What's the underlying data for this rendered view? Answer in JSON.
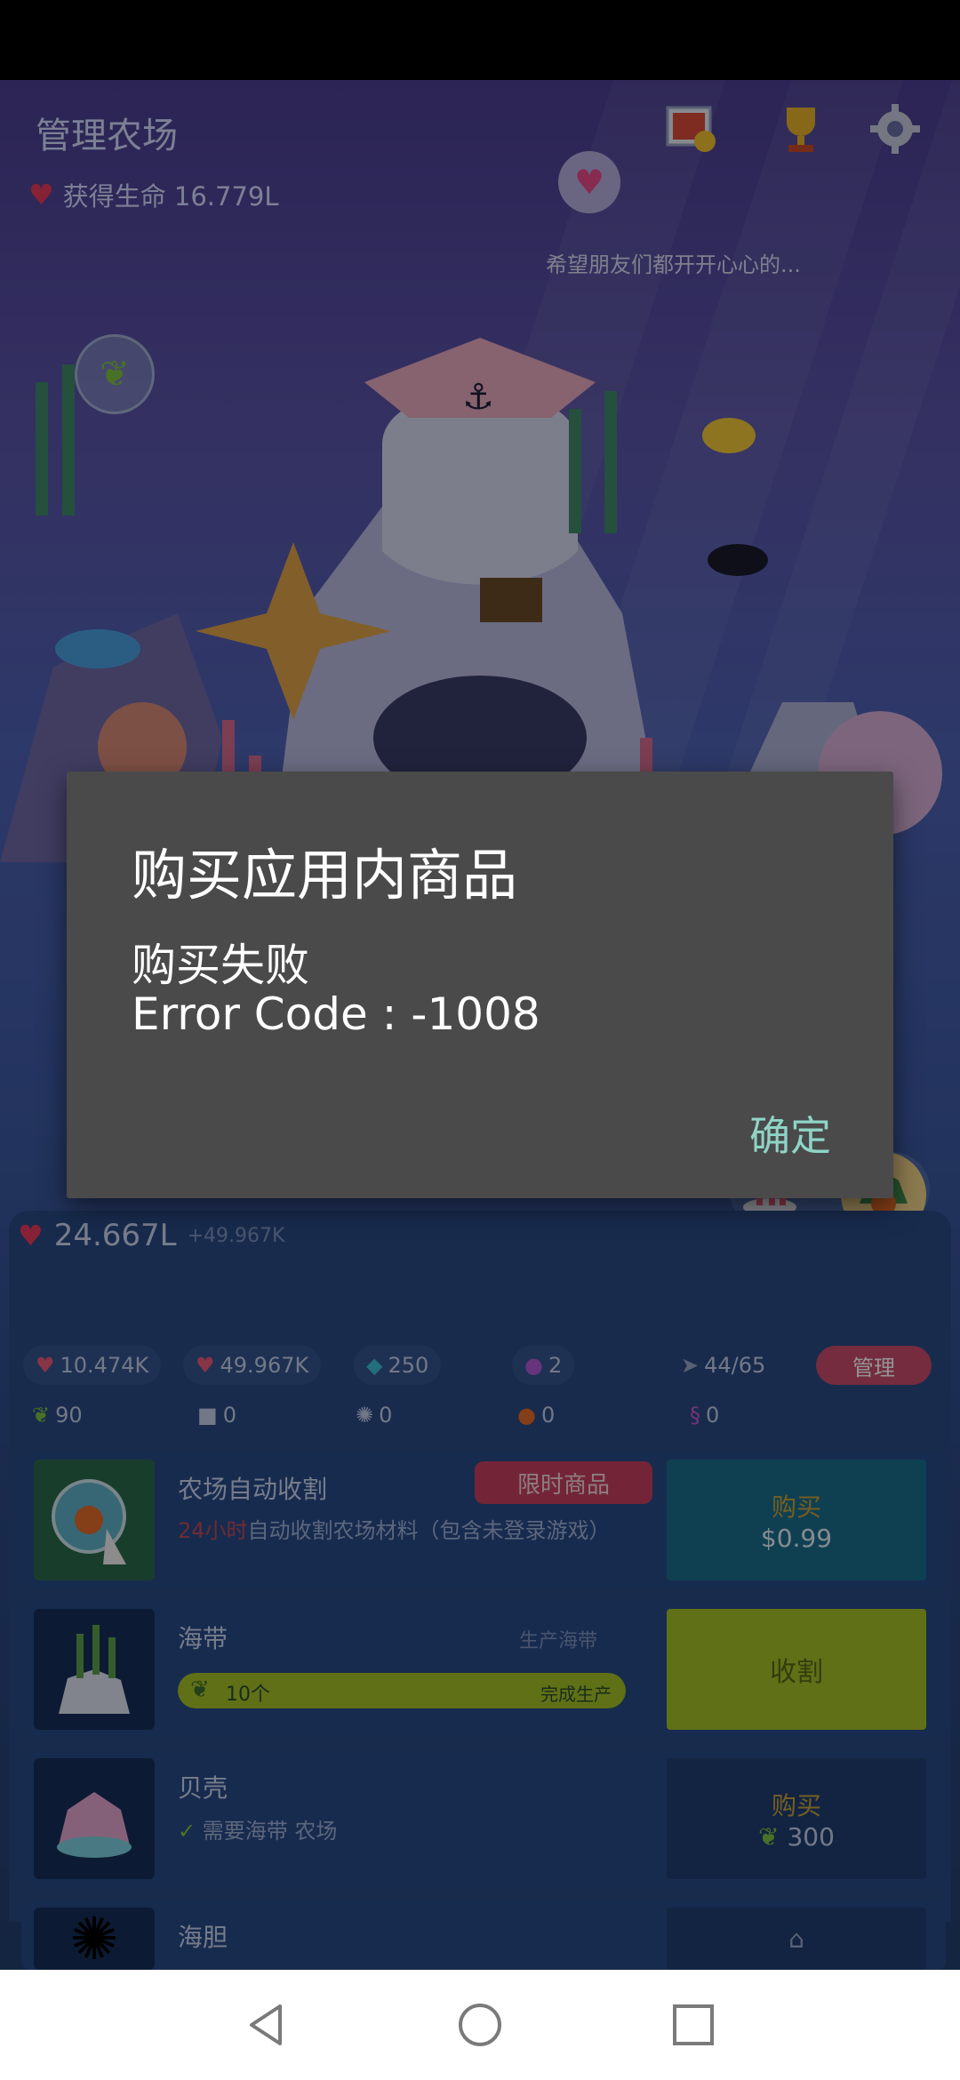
{
  "hud": {
    "title": "管理农场",
    "life_label": "获得生命 16.779L",
    "speech": "希望朋友们都开开心心的..."
  },
  "panel": {
    "life_value": "24.667L",
    "life_rate": "+49.967K",
    "stats_row1": [
      {
        "icon": "hand-heart-icon",
        "value": "10.474K"
      },
      {
        "icon": "heart-bag-icon",
        "value": "49.967K"
      },
      {
        "icon": "gem-icon",
        "value": "250"
      },
      {
        "icon": "coin-icon",
        "value": "2"
      },
      {
        "icon": "fish-icon",
        "value": "44/65"
      }
    ],
    "manage_label": "管理",
    "stats_row2": [
      {
        "icon": "seaweed-icon",
        "value": "90"
      },
      {
        "icon": "shell-icon",
        "value": "0"
      },
      {
        "icon": "urchin-icon",
        "value": "0"
      },
      {
        "icon": "crab-icon",
        "value": "0"
      },
      {
        "icon": "seahorse-icon",
        "value": "0"
      }
    ]
  },
  "items": [
    {
      "title": "农场自动收割",
      "tag": "限时商品",
      "highlight": "24小时",
      "sub": "自动收割农场材料（包含未登录游戏）",
      "action_top": "购买",
      "action_bottom": "$0.99"
    },
    {
      "title": "海带",
      "right_sub": "生产海带",
      "progress_left": "10个",
      "progress_right": "完成生产",
      "progress_fraction": 1.0,
      "action": "收割"
    },
    {
      "title": "贝壳",
      "sub": "需要海带 农场",
      "action_top": "购买",
      "action_bottom": "300"
    },
    {
      "title": "海胆"
    }
  ],
  "dialog": {
    "title": "购买应用内商品",
    "line1": "购买失败",
    "line2": "Error Code : -1008",
    "ok": "确定"
  },
  "colors": {
    "dialog_bg": "#4a4a4a",
    "ok_text": "#8fd4c6",
    "tag_red": "#c6405f",
    "buy_teal": "#1b6e8d",
    "harvest_lime": "#a5c228"
  }
}
